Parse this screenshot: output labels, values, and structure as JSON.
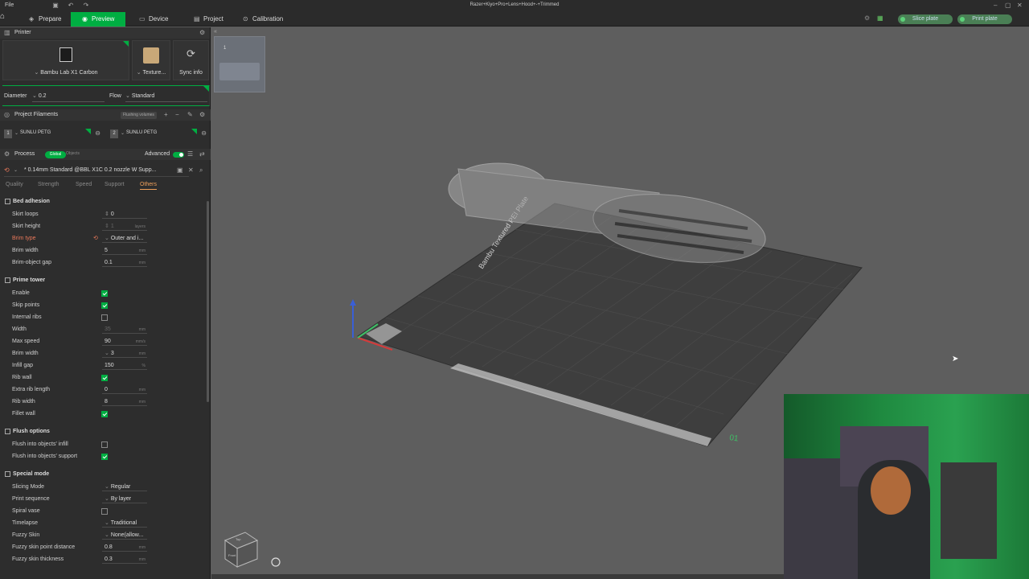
{
  "app": {
    "file_menu": "File",
    "title": "Razer+Kiyo+Pro+Lens+Hood+-+Trimmed"
  },
  "tabs": [
    {
      "label": "Prepare",
      "icon": "cube-icon"
    },
    {
      "label": "Preview",
      "icon": "eye-icon",
      "active": true
    },
    {
      "label": "Device",
      "icon": "monitor-icon"
    },
    {
      "label": "Project",
      "icon": "file-icon"
    },
    {
      "label": "Calibration",
      "icon": "target-icon"
    }
  ],
  "actions": {
    "slice": "Slice plate",
    "print": "Print plate"
  },
  "printer": {
    "section": "Printer",
    "model": "Bambu Lab X1 Carbon",
    "plate": "Texture...",
    "sync": "Sync info",
    "diameter_label": "Diameter",
    "diameter_value": "0.2",
    "flow_label": "Flow",
    "flow_value": "Standard"
  },
  "filaments": {
    "section": "Project Filaments",
    "flushing_btn": "Flushing volumes",
    "items": [
      {
        "num": "1",
        "name": "SUNLU PETG"
      },
      {
        "num": "2",
        "name": "SUNLU PETG"
      }
    ]
  },
  "process": {
    "section": "Process",
    "toggle_global": "Global",
    "toggle_objects": "Objects",
    "advanced": "Advanced",
    "preset": "* 0.14mm Standard @BBL X1C 0.2 nozzle W Supp...",
    "subtabs": [
      "Quality",
      "Strength",
      "Speed",
      "Support",
      "Others"
    ],
    "active_subtab": "Others"
  },
  "groups": {
    "bed": {
      "title": "Bed adhesion",
      "rows": [
        {
          "label": "Skirt loops",
          "value": "0",
          "unit": ""
        },
        {
          "label": "Skirt height",
          "value": "1",
          "unit": "layers"
        },
        {
          "label": "Brim type",
          "value": "Outer and i...",
          "unit": ""
        },
        {
          "label": "Brim width",
          "value": "5",
          "unit": "mm"
        },
        {
          "label": "Brim-object gap",
          "value": "0.1",
          "unit": "mm"
        }
      ]
    },
    "prime": {
      "title": "Prime tower",
      "rows": [
        {
          "label": "Enable"
        },
        {
          "label": "Skip points"
        },
        {
          "label": "Internal ribs"
        },
        {
          "label": "Width",
          "value": "35",
          "unit": "mm"
        },
        {
          "label": "Max speed",
          "value": "90",
          "unit": "mm/s"
        },
        {
          "label": "Brim width",
          "value": "3",
          "unit": "mm"
        },
        {
          "label": "Infill gap",
          "value": "150",
          "unit": "%"
        },
        {
          "label": "Rib wall"
        },
        {
          "label": "Extra rib length",
          "value": "0",
          "unit": "mm"
        },
        {
          "label": "Rib width",
          "value": "8",
          "unit": "mm"
        },
        {
          "label": "Fillet wall"
        }
      ]
    },
    "flush": {
      "title": "Flush options",
      "rows": [
        {
          "label": "Flush into objects' infill"
        },
        {
          "label": "Flush into objects' support"
        }
      ]
    },
    "special": {
      "title": "Special mode",
      "rows": [
        {
          "label": "Slicing Mode",
          "value": "Regular"
        },
        {
          "label": "Print sequence",
          "value": "By layer"
        },
        {
          "label": "Spiral vase"
        },
        {
          "label": "Timelapse",
          "value": "Traditional"
        },
        {
          "label": "Fuzzy Skin",
          "value": "None(allow..."
        },
        {
          "label": "Fuzzy skin point distance",
          "value": "0.8",
          "unit": "mm"
        },
        {
          "label": "Fuzzy skin thickness",
          "value": "0.3",
          "unit": "mm"
        }
      ]
    }
  },
  "viewport": {
    "plate_thumb_num": "1",
    "plate_label": "Bambu Textured PEI Plate",
    "plate_num": "01",
    "nav_cube_top": "Top",
    "nav_cube_front": "Front"
  },
  "colors": {
    "accent": "#00ae42",
    "highlight": "#e8785a",
    "tab_active": "#f0a05a"
  }
}
